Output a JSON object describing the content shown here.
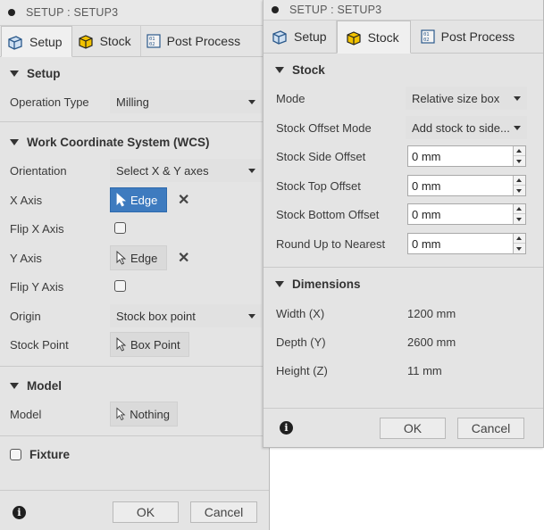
{
  "dialog_left": {
    "title": "SETUP : SETUP3",
    "tabs": [
      {
        "label": "Setup",
        "icon": "setup-icon",
        "active": true
      },
      {
        "label": "Stock",
        "icon": "stock-cube-icon",
        "active": false
      },
      {
        "label": "Post Process",
        "icon": "post-process-icon",
        "active": false
      }
    ],
    "setup_section": {
      "heading": "Setup",
      "operation_type_label": "Operation Type",
      "operation_type_value": "Milling"
    },
    "wcs_section": {
      "heading": "Work Coordinate System (WCS)",
      "orientation_label": "Orientation",
      "orientation_value": "Select X & Y axes",
      "x_axis_label": "X Axis",
      "x_axis_value": "Edge",
      "flip_x_label": "Flip X Axis",
      "y_axis_label": "Y Axis",
      "y_axis_value": "Edge",
      "flip_y_label": "Flip Y Axis",
      "origin_label": "Origin",
      "origin_value": "Stock box point",
      "stock_point_label": "Stock Point",
      "stock_point_value": "Box Point"
    },
    "model_section": {
      "heading": "Model",
      "model_label": "Model",
      "model_value": "Nothing"
    },
    "fixture_label": "Fixture",
    "ok_label": "OK",
    "cancel_label": "Cancel"
  },
  "dialog_right": {
    "title": "SETUP : SETUP3",
    "tabs": [
      {
        "label": "Setup",
        "icon": "setup-icon",
        "active": false
      },
      {
        "label": "Stock",
        "icon": "stock-cube-icon",
        "active": true
      },
      {
        "label": "Post Process",
        "icon": "post-process-icon",
        "active": false
      }
    ],
    "stock_section": {
      "heading": "Stock",
      "mode_label": "Mode",
      "mode_value": "Relative size box",
      "offset_mode_label": "Stock Offset Mode",
      "offset_mode_value": "Add stock to side...",
      "side_offset_label": "Stock Side Offset",
      "side_offset_value": "0 mm",
      "top_offset_label": "Stock Top Offset",
      "top_offset_value": "0 mm",
      "bottom_offset_label": "Stock Bottom Offset",
      "bottom_offset_value": "0 mm",
      "round_up_label": "Round Up to Nearest",
      "round_up_value": "0 mm"
    },
    "dimensions_section": {
      "heading": "Dimensions",
      "width_label": "Width (X)",
      "width_value": "1200 mm",
      "depth_label": "Depth (Y)",
      "depth_value": "2600 mm",
      "height_label": "Height (Z)",
      "height_value": "11 mm"
    },
    "ok_label": "OK",
    "cancel_label": "Cancel"
  },
  "colors": {
    "panel_bg": "#e4e4e4",
    "selected_button": "#3e7bbf",
    "cube_icon": "#f2c200"
  }
}
